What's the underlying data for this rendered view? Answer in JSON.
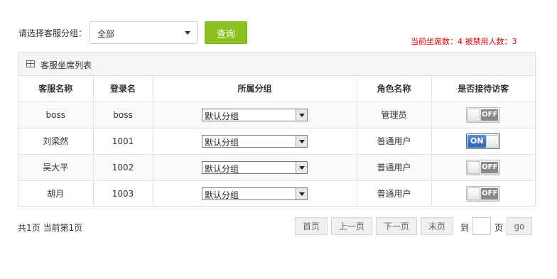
{
  "filter": {
    "label": "请选择客服分组：",
    "selected": "全部",
    "query_label": "查询"
  },
  "stats": {
    "text": "当前坐席数：4  被禁用人数：3"
  },
  "panel": {
    "title": "客服坐席列表"
  },
  "table": {
    "headers": [
      "客服名称",
      "登录名",
      "所属分组",
      "角色名称",
      "是否接待访客"
    ],
    "rows": [
      {
        "name": "boss",
        "login": "boss",
        "group": "默认分组",
        "role": "管理员",
        "receive": "OFF"
      },
      {
        "name": "刘梁然",
        "login": "1001",
        "group": "默认分组",
        "role": "普通用户",
        "receive": "ON"
      },
      {
        "name": "吴大平",
        "login": "1002",
        "group": "默认分组",
        "role": "普通用户",
        "receive": "OFF"
      },
      {
        "name": "胡月",
        "login": "1003",
        "group": "默认分组",
        "role": "普通用户",
        "receive": "OFF"
      }
    ]
  },
  "pagination": {
    "info": "共1页 当前第1页",
    "first": "首页",
    "prev": "上一页",
    "next": "下一页",
    "last": "末页",
    "to": "到",
    "page_unit": "页",
    "go": "go",
    "page_input": ""
  },
  "colors": {
    "accent_green": "#8cc21f",
    "stats_red": "#e60000",
    "toggle_on_blue": "#2f64a8"
  }
}
